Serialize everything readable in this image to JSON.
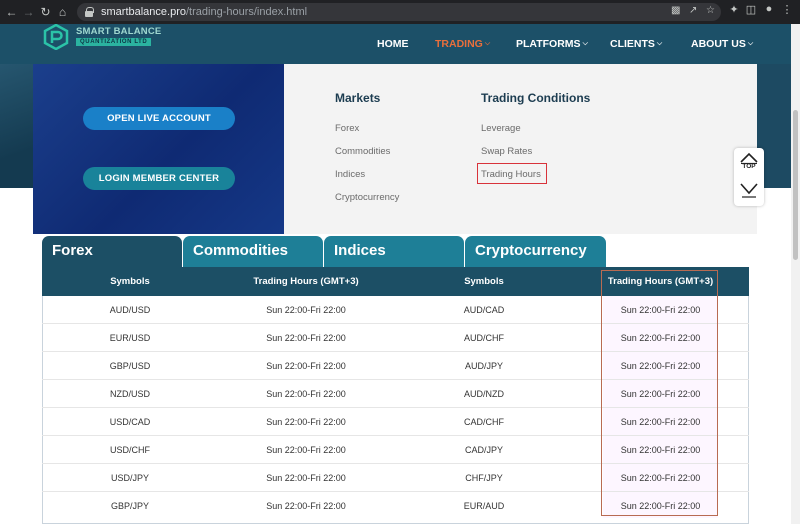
{
  "browser": {
    "url_host": "smartbalance.pro",
    "url_path": "/trading-hours/index.html",
    "nav_icons": [
      "back-arrow-icon",
      "forward-arrow-icon",
      "reload-icon",
      "home-icon"
    ],
    "right_icons": [
      "translate-icon",
      "share-icon",
      "star-icon",
      "extensions-icon",
      "sidebar-icon",
      "profile-icon",
      "menu-icon"
    ]
  },
  "header": {
    "logo_name": "SMART BALANCE",
    "logo_sub": "QUANTIZATION  LTD",
    "nav": [
      {
        "label": "HOME",
        "dropdown": false,
        "active": false
      },
      {
        "label": "TRADING",
        "dropdown": true,
        "active": true
      },
      {
        "label": "PLATFORMS",
        "dropdown": true,
        "active": false
      },
      {
        "label": "CLIENTS",
        "dropdown": true,
        "active": false
      },
      {
        "label": "ABOUT US",
        "dropdown": true,
        "active": false
      }
    ],
    "accent": "#e96f3c"
  },
  "dropdown": {
    "open_live": "OPEN LIVE ACCOUNT",
    "login": "LOGIN MEMBER CENTER",
    "markets_title": "Markets",
    "markets": [
      "Forex",
      "Commodities",
      "Indices",
      "Cryptocurrency"
    ],
    "conditions_title": "Trading Conditions",
    "conditions": [
      "Leverage",
      "Swap Rates",
      "Trading Hours"
    ],
    "highlight": "Trading Hours"
  },
  "top_button": {
    "label": "TOP"
  },
  "tabs": [
    "Forex",
    "Commodities",
    "Indices",
    "Cryptocurrency"
  ],
  "active_tab": "Forex",
  "table": {
    "headers": [
      "Symbols",
      "Trading Hours (GMT+3)",
      "Symbols",
      "Trading Hours (GMT+3)"
    ],
    "rows": [
      [
        "AUD/USD",
        "Sun 22:00-Fri 22:00",
        "AUD/CAD",
        "Sun 22:00-Fri 22:00"
      ],
      [
        "EUR/USD",
        "Sun 22:00-Fri 22:00",
        "AUD/CHF",
        "Sun 22:00-Fri 22:00"
      ],
      [
        "GBP/USD",
        "Sun 22:00-Fri 22:00",
        "AUD/JPY",
        "Sun 22:00-Fri 22:00"
      ],
      [
        "NZD/USD",
        "Sun 22:00-Fri 22:00",
        "AUD/NZD",
        "Sun 22:00-Fri 22:00"
      ],
      [
        "USD/CAD",
        "Sun 22:00-Fri 22:00",
        "CAD/CHF",
        "Sun 22:00-Fri 22:00"
      ],
      [
        "USD/CHF",
        "Sun 22:00-Fri 22:00",
        "CAD/JPY",
        "Sun 22:00-Fri 22:00"
      ],
      [
        "USD/JPY",
        "Sun 22:00-Fri 22:00",
        "CHF/JPY",
        "Sun 22:00-Fri 22:00"
      ],
      [
        "GBP/JPY",
        "Sun 22:00-Fri 22:00",
        "EUR/AUD",
        "Sun 22:00-Fri 22:00"
      ]
    ]
  }
}
